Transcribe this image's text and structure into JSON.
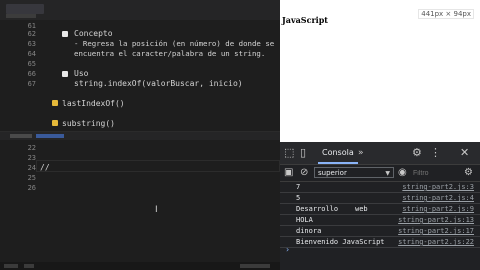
{
  "editor": {
    "top_lines": [
      {
        "num": "61",
        "text": ""
      },
      {
        "num": "62",
        "text": "Concepto"
      },
      {
        "num": "63",
        "text": "- Regresa la posición (en número) de donde se"
      },
      {
        "num": "64",
        "text": "encuentra el caracter/palabra de un string."
      },
      {
        "num": "65",
        "text": ""
      },
      {
        "num": "66",
        "text": "Uso"
      },
      {
        "num": "67",
        "text": "string.indexOf(valorBuscar, inicio)"
      }
    ],
    "sections": [
      {
        "label": "lastIndexOf()"
      },
      {
        "label": "substring()"
      }
    ],
    "bottom_lines": [
      {
        "num": "22",
        "text": ""
      },
      {
        "num": "23",
        "text": ""
      },
      {
        "num": "24",
        "text": "//"
      },
      {
        "num": "25",
        "text": ""
      },
      {
        "num": "26",
        "text": ""
      }
    ]
  },
  "browser": {
    "heading": "JavaScript",
    "dimensions_badge": "441px × 94px"
  },
  "devtools": {
    "tabs": {
      "console": "Consola",
      "more": "»"
    },
    "toolbar": {
      "context": "superior",
      "filter_placeholder": "Filtro"
    },
    "console_rows": [
      {
        "message": "7",
        "source": "string-part2.js:3"
      },
      {
        "message": "5",
        "source": "string-part2.js:4"
      },
      {
        "message": "Desarrollo    web",
        "source": "string-part2.js:9"
      },
      {
        "message": "HOLA",
        "source": "string-part2.js:13"
      },
      {
        "message": "dinora",
        "source": "string-part2.js:17"
      },
      {
        "message": "Bienvenido JavaScript",
        "source": "string-part2.js:22"
      }
    ],
    "prompt": "›"
  },
  "colors": {
    "editor_bg": "#1e1e1e",
    "devtools_bg": "#202124",
    "accent": "#8ab4f8",
    "markdown_bullet": "#e5b93a"
  }
}
